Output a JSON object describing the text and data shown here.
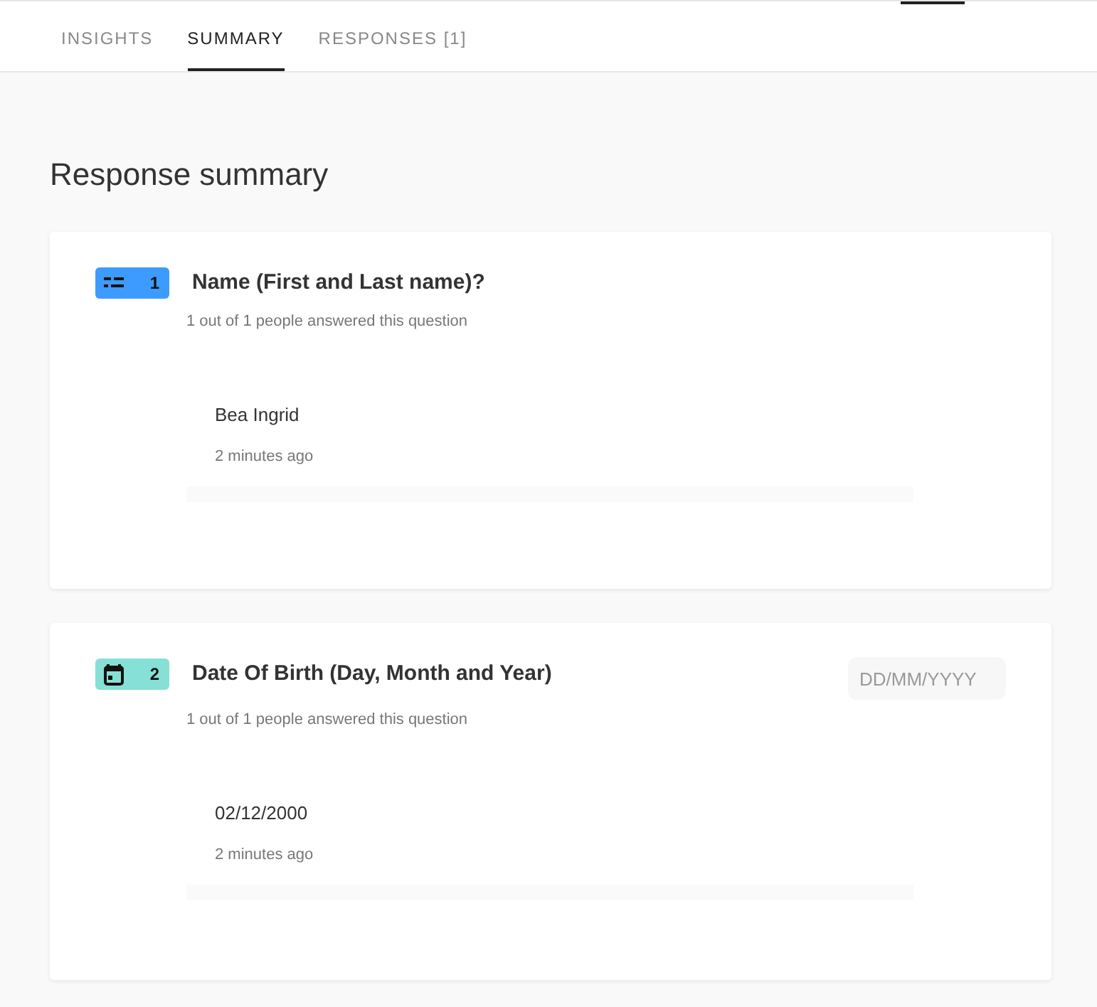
{
  "tabs": [
    {
      "label": "INSIGHTS",
      "selected": false
    },
    {
      "label": "SUMMARY",
      "selected": true
    },
    {
      "label": "RESPONSES [1]",
      "selected": false
    }
  ],
  "heading": "Response summary",
  "questions": [
    {
      "kind": "text",
      "number": "1",
      "color": "#3d9bff",
      "title": "Name (First and Last name)?",
      "answered": "1 out of 1 people answered this question",
      "answers": [
        {
          "value": "Bea Ingrid",
          "time": "2 minutes ago"
        }
      ]
    },
    {
      "kind": "date",
      "number": "2",
      "color": "#86e0d5",
      "title": "Date Of Birth (Day, Month and Year)",
      "placeholder": "DD/MM/YYYY",
      "answered": "1 out of 1 people answered this question",
      "answers": [
        {
          "value": "02/12/2000",
          "time": "2 minutes ago"
        }
      ]
    }
  ]
}
